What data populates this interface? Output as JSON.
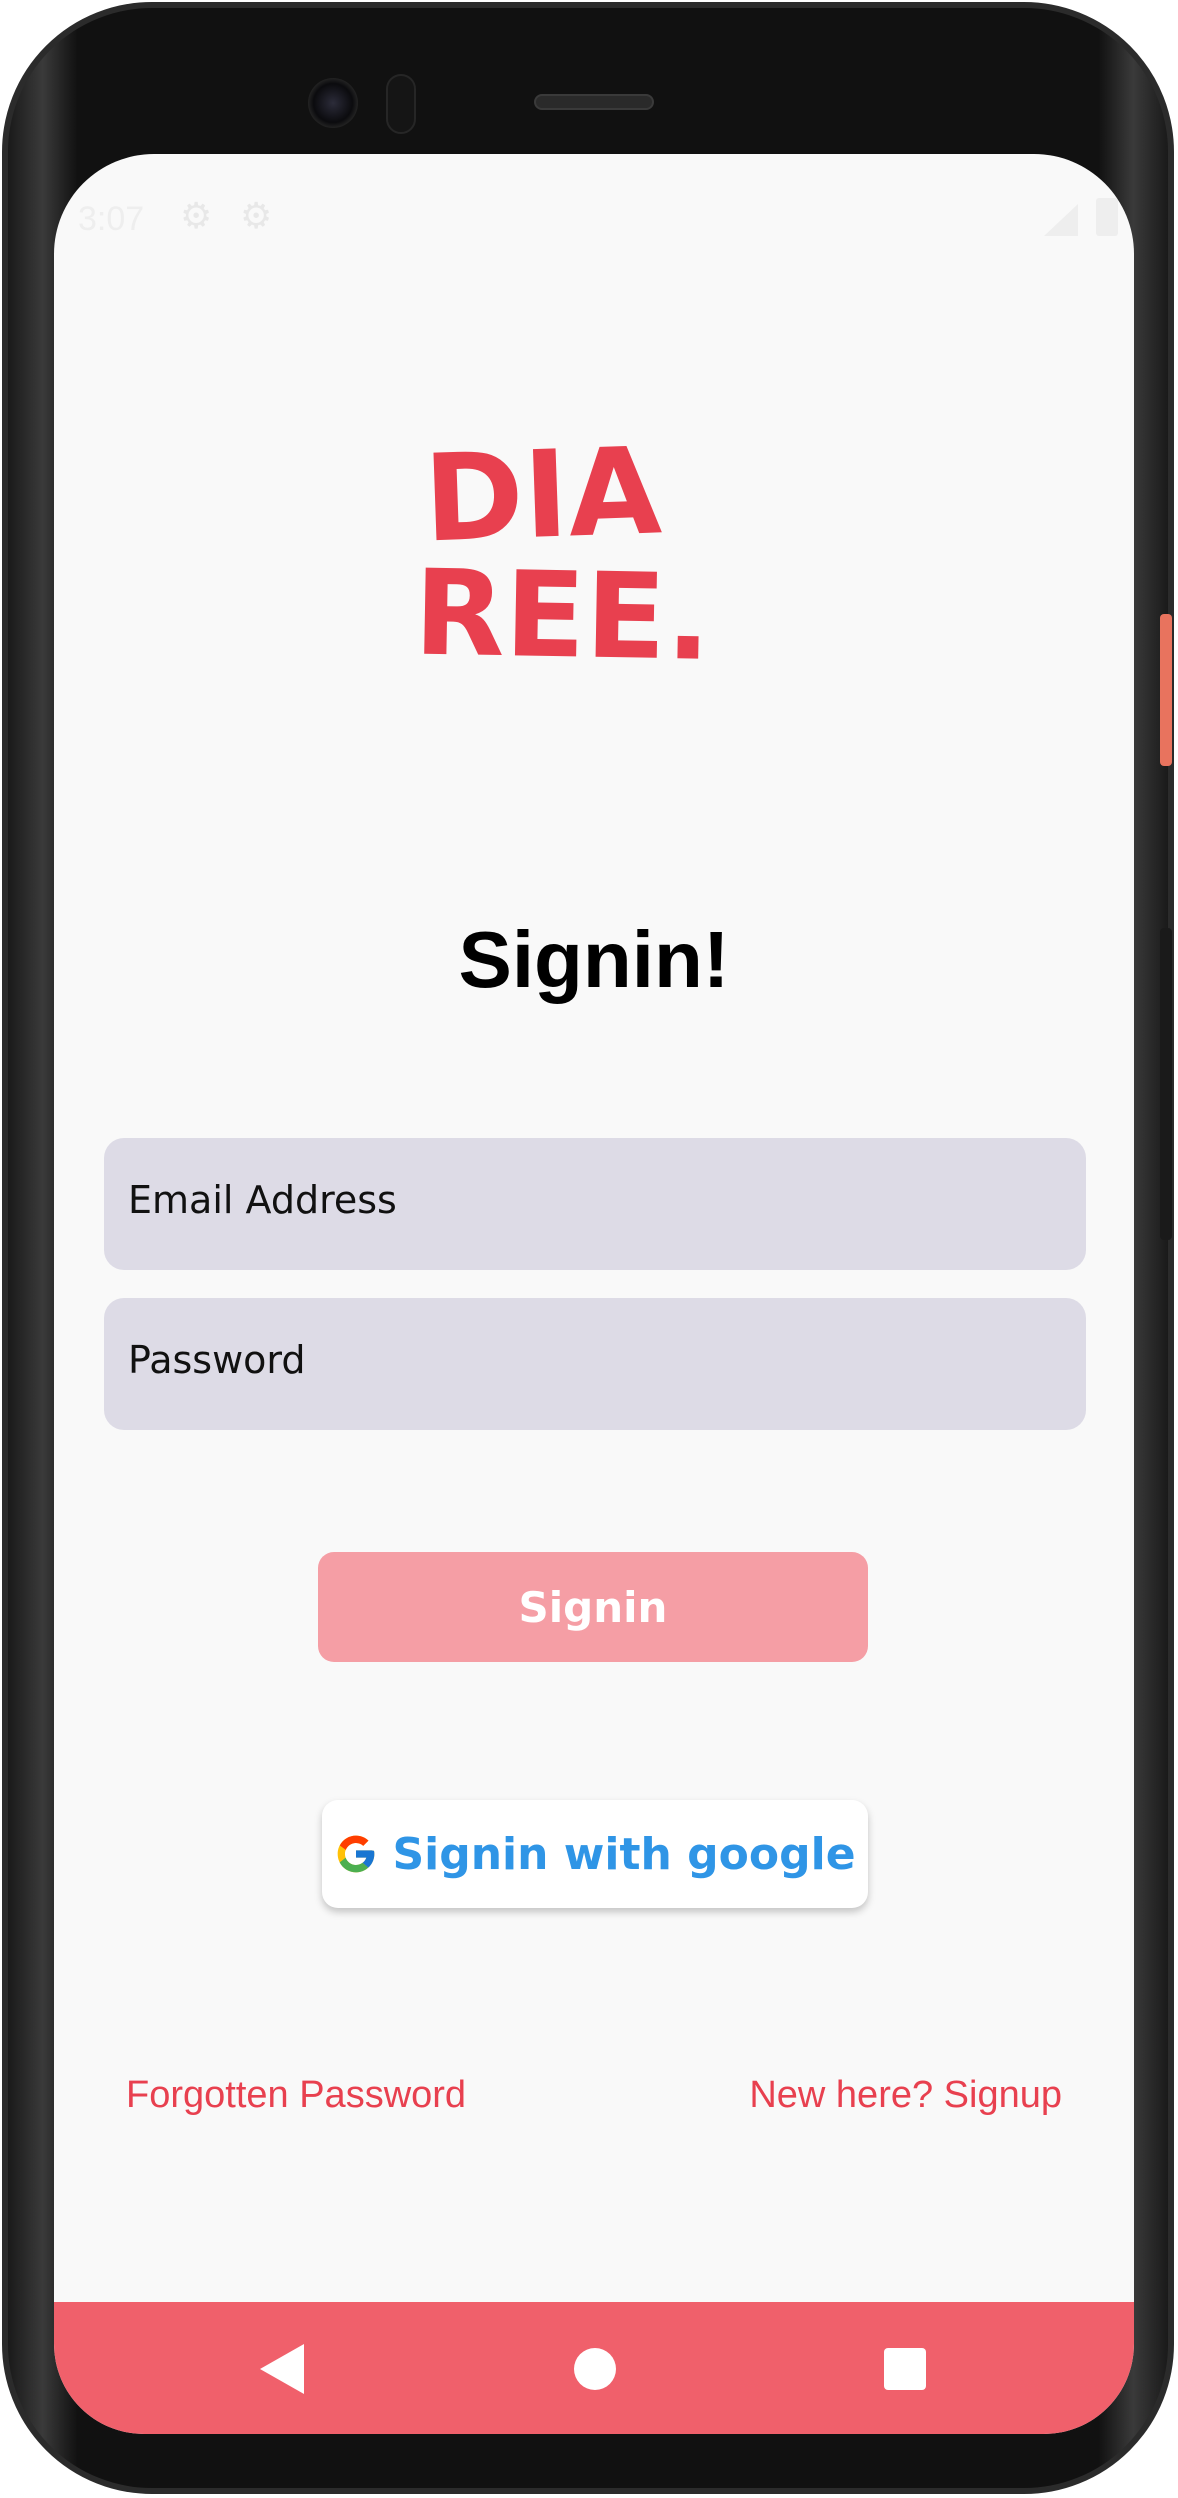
{
  "status_bar": {
    "time": "3:07",
    "icons": [
      "gear-icon",
      "gear-icon",
      "signal-icon",
      "battery-icon"
    ]
  },
  "logo": {
    "line1": "DIA",
    "line2": "REE.",
    "color": "#e8404f"
  },
  "title": "Signin!",
  "form": {
    "email_placeholder": "Email Address",
    "password_placeholder": "Password"
  },
  "buttons": {
    "signin_label": "Signin",
    "google_label": "Signin with google"
  },
  "links": {
    "forgot_password": "Forgotten Password",
    "signup": "New here? Signup"
  },
  "nav_bar": {
    "color": "#f0606b",
    "icons": [
      "back-icon",
      "home-icon",
      "recents-icon"
    ]
  },
  "colors": {
    "accent": "#e8404f",
    "signin_button": "#f59ea5",
    "google_text": "#2f95e6",
    "field_background": "#dddbe6"
  }
}
